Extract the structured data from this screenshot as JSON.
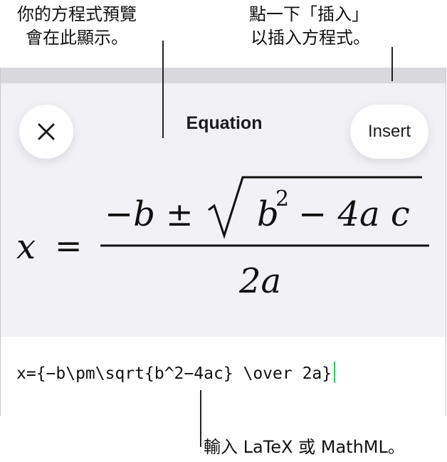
{
  "callouts": {
    "preview_line1": "你的方程式預覽",
    "preview_line2": "會在此顯示。",
    "insert_line1": "點一下「插入」",
    "insert_line2": "以插入方程式。",
    "input": "輸入 LaTeX 或 MathML。"
  },
  "sheet": {
    "title": "Equation",
    "close_icon": "close-icon",
    "insert_label": "Insert"
  },
  "equation": {
    "lhs": "x",
    "equals": "=",
    "numerator_minus_b": "−b",
    "plus_minus": "±",
    "b": "b",
    "exponent": "2",
    "minus_4ac": "− 4a c",
    "denominator": "2a"
  },
  "input": {
    "value": "x={−b\\pm\\sqrt{b^2−4ac} \\over 2a}"
  },
  "colors": {
    "cursor": "#34c759",
    "sheet_background": "#f2f2f6"
  }
}
